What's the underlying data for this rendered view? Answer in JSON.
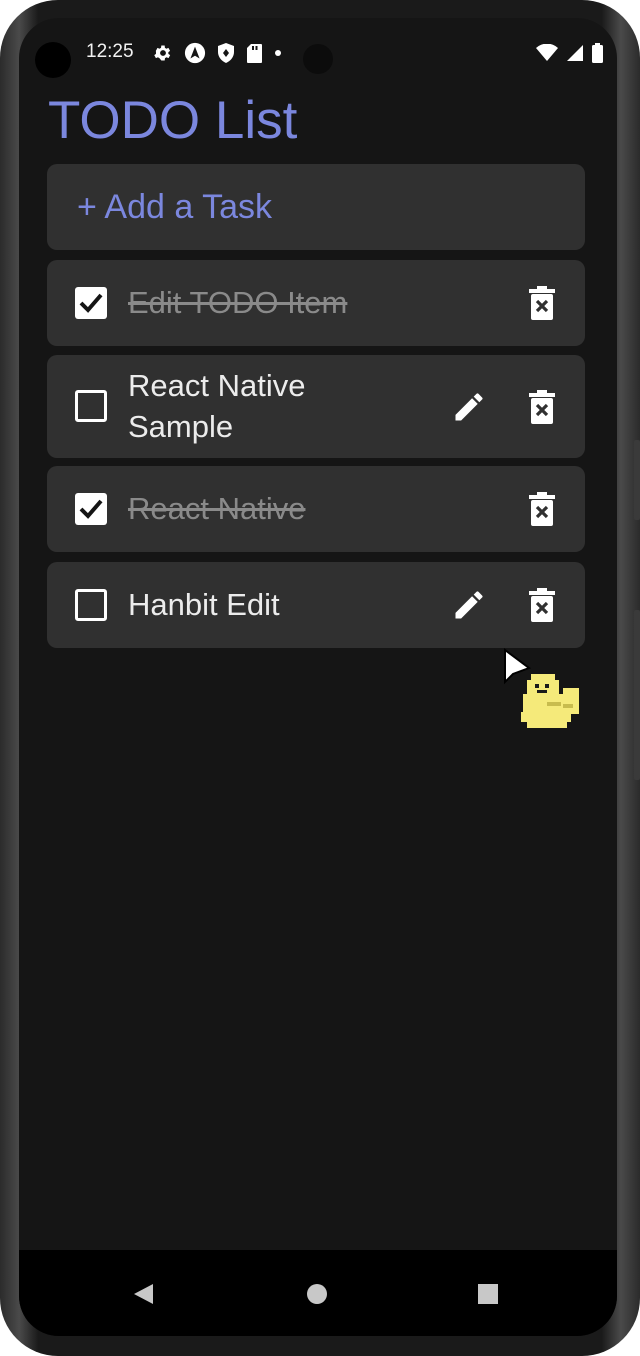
{
  "status_bar": {
    "time": "12:25",
    "left_icons": [
      "settings-icon",
      "navigation-icon",
      "shield-icon",
      "sd-card-icon",
      "dot-icon"
    ],
    "right_icons": [
      "wifi-icon",
      "cell-signal-icon",
      "battery-icon"
    ]
  },
  "app": {
    "title": "TODO List",
    "add_task_label": "+ Add a Task",
    "accent_color": "#7b87de"
  },
  "tasks": [
    {
      "text": "Edit TODO Item",
      "completed": true,
      "editable": false
    },
    {
      "text": "React Native Sample",
      "completed": false,
      "editable": true
    },
    {
      "text": "React Native",
      "completed": true,
      "editable": false
    },
    {
      "text": "Hanbit Edit",
      "completed": false,
      "editable": true
    }
  ],
  "nav_bar": {
    "buttons": [
      "back-icon",
      "home-icon",
      "recents-icon"
    ]
  }
}
